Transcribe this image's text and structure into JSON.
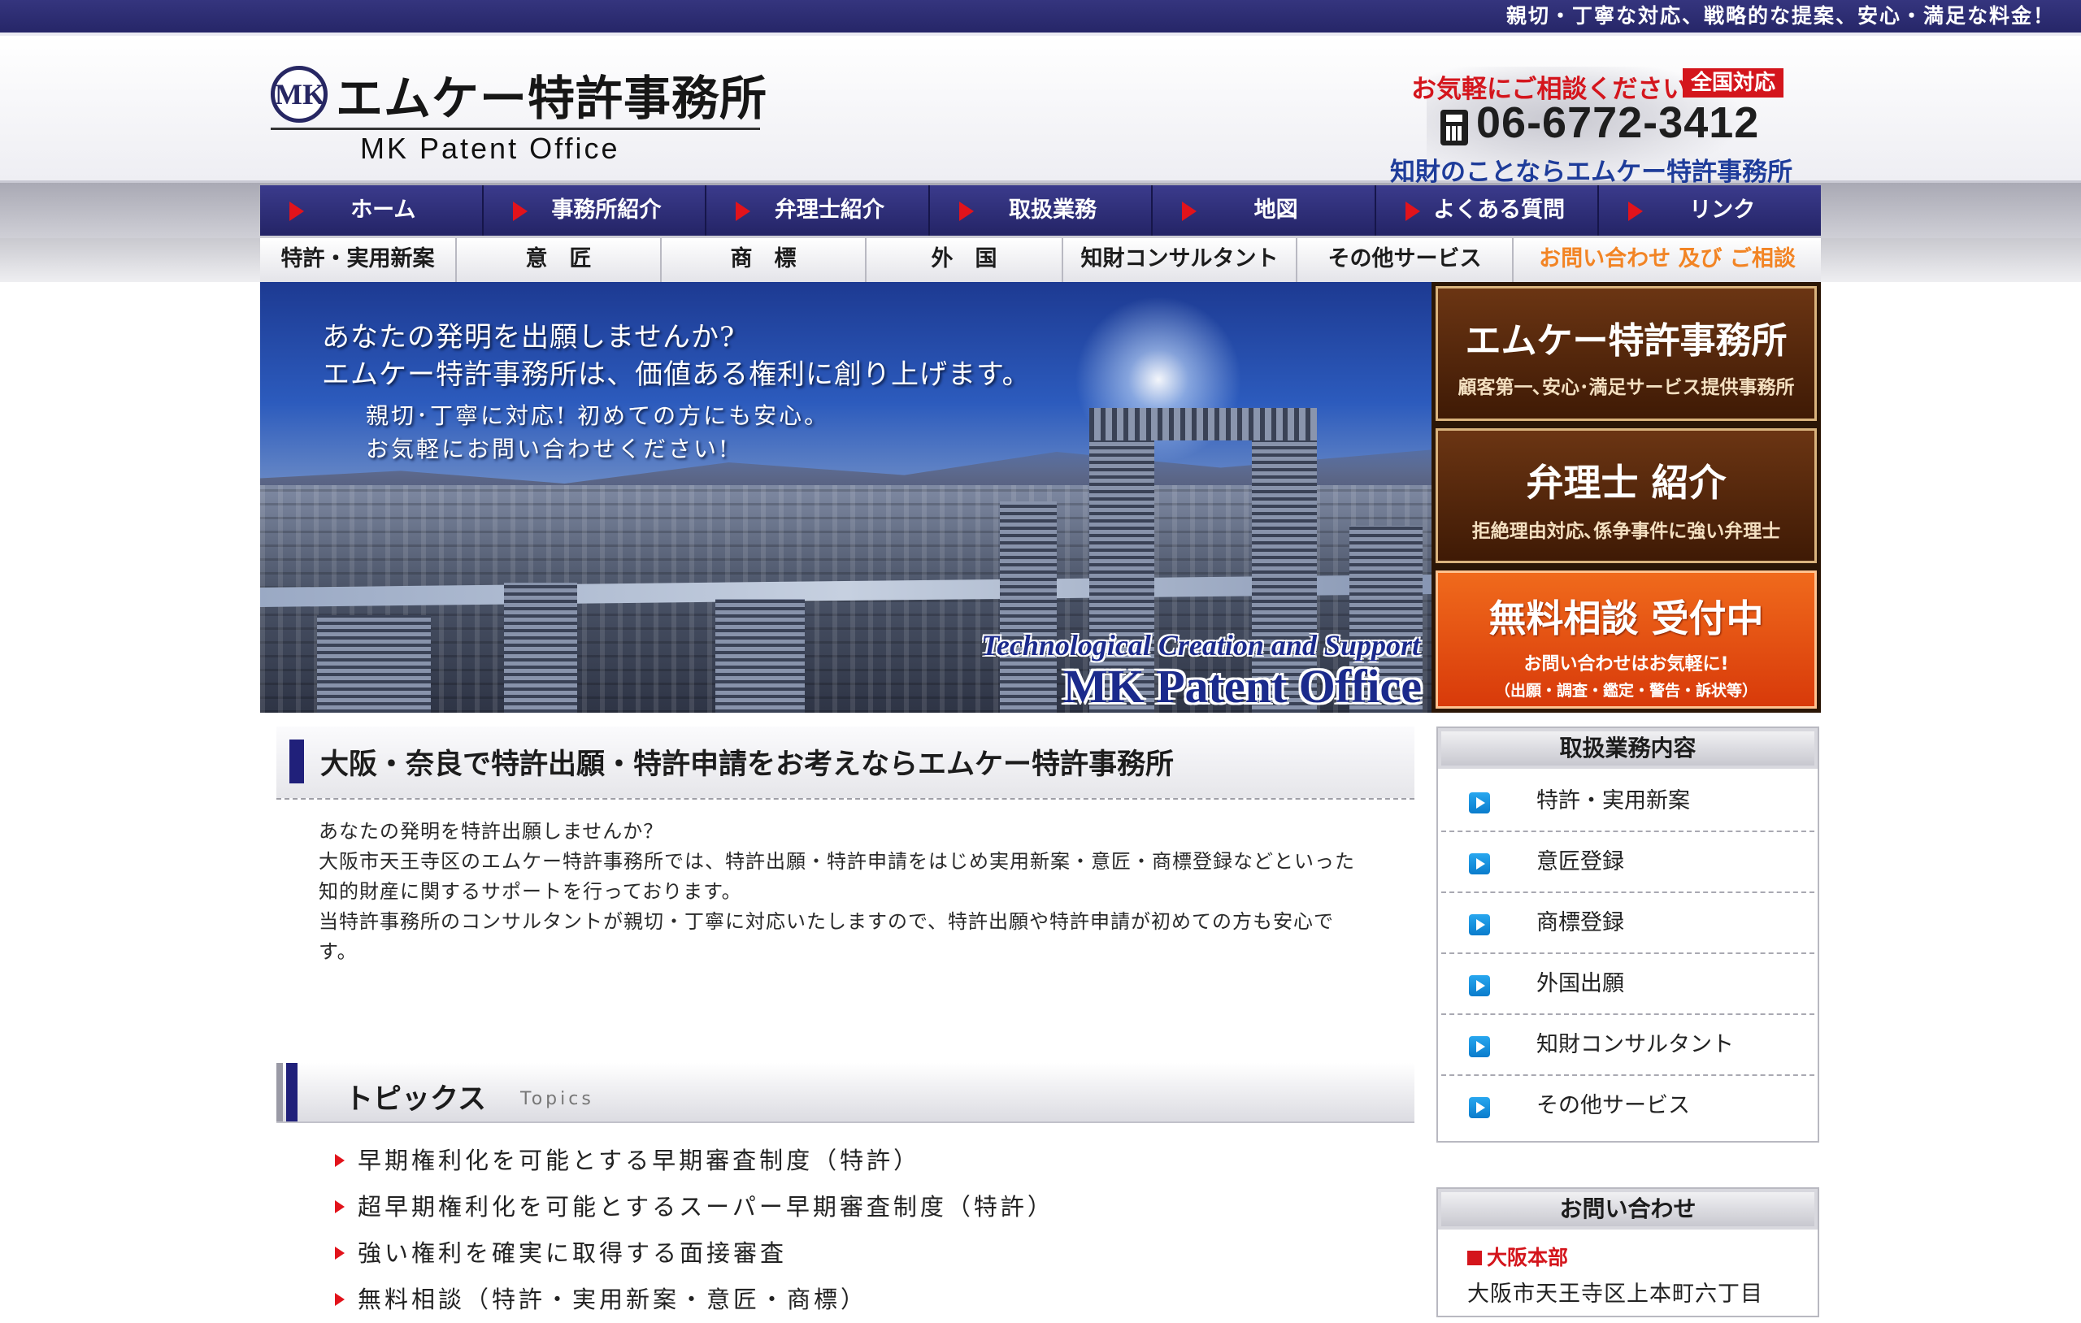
{
  "topbar": {
    "tagline": "親切・丁寧な対応、戦略的な提案、安心・満足な料金！"
  },
  "header": {
    "logo_mark": "MK",
    "logo_jp": "エムケー特許事務所",
    "logo_en": "MK Patent Office",
    "contact_lead": "お気軽にご相談ください",
    "nationwide": "全国対応",
    "phone": "06-6772-3412",
    "contact_note": "知財のことならエムケー特許事務所へ"
  },
  "main_nav": [
    {
      "label": "ホーム"
    },
    {
      "label": "事務所紹介"
    },
    {
      "label": "弁理士紹介"
    },
    {
      "label": "取扱業務"
    },
    {
      "label": "地図"
    },
    {
      "label": "よくある質問"
    },
    {
      "label": "リンク"
    }
  ],
  "sub_nav": [
    {
      "label": "特許・実用新案"
    },
    {
      "label": "意　匠"
    },
    {
      "label": "商　標"
    },
    {
      "label": "外　国"
    },
    {
      "label": "知財コンサルタント"
    },
    {
      "label": "その他サービス"
    },
    {
      "label": "お問い合わせ 及び ご相談"
    }
  ],
  "hero": {
    "line1": "あなたの発明を出願しませんか?",
    "line2": "エムケー特許事務所は、価値ある権利に創り上げます。",
    "line3": "親切･丁寧に対応! 初めての方にも安心。",
    "line4": "お気軽にお問い合わせください!",
    "caption1": "Technological Creation and Support",
    "caption2": "MK Patent Office"
  },
  "promos": {
    "office": {
      "title": "エムケー特許事務所",
      "sub": "顧客第一､安心･満足サービス提供事務所"
    },
    "attorney": {
      "title": "弁理士 紹介",
      "sub": "拒絶理由対応､係争事件に強い弁理士"
    },
    "free": {
      "title": "無料相談 受付中",
      "sub": "お問い合わせはお気軽に!",
      "sub2": "（出願・調査・鑑定・警告・訴状等）"
    }
  },
  "main": {
    "heading": "大阪・奈良で特許出願・特許申請をお考えならエムケー特許事務所",
    "intro": [
      "あなたの発明を特許出願しませんか？",
      "大阪市天王寺区のエムケー特許事務所では、特許出願・特許申請をはじめ実用新案・意匠・商標登録などといった",
      "知的財産に関するサポートを行っております。",
      "当特許事務所のコンサルタントが親切・丁寧に対応いたしますので、特許出願や特許申請が初めての方も安心で",
      "す。"
    ],
    "topics_title": "トピックス",
    "topics_sub": "Topics",
    "topics": [
      "早期権利化を可能とする早期審査制度（特許）",
      "超早期権利化を可能とするスーパー早期審査制度（特許）",
      "強い権利を確実に取得する面接審査",
      "無料相談（特許・実用新案・意匠・商標）"
    ]
  },
  "sidebar": {
    "services_title": "取扱業務内容",
    "services": [
      "特許・実用新案",
      "意匠登録",
      "商標登録",
      "外国出願",
      "知財コンサルタント",
      "その他サービス"
    ],
    "contact_title": "お問い合わせ",
    "branch": "大阪本部",
    "address": "大阪市天王寺区上本町六丁目"
  },
  "colors": {
    "navy": "#262668",
    "accent_red": "#d4151c",
    "inquiry_orange": "#f28424",
    "promo_brown": "#4f240a",
    "promo_orange": "#e6521a",
    "service_icon_blue": "#1792dd"
  },
  "icons": {
    "nav_arrow": "red-triangle-icon",
    "phone": "phone-icon",
    "service_bullet": "blue-play-icon",
    "topic_bullet": "red-triangle-icon"
  }
}
